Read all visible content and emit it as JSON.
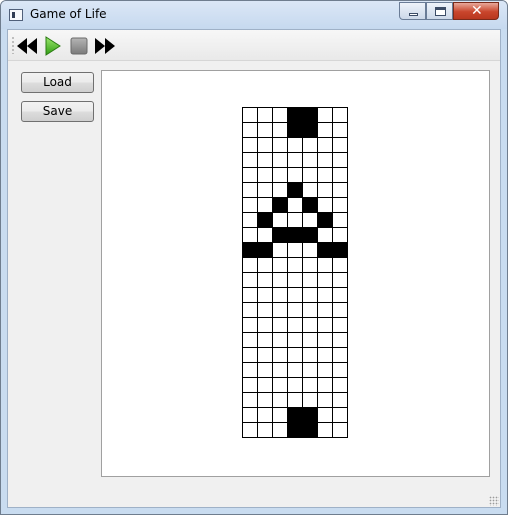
{
  "window": {
    "title": "Game of Life"
  },
  "toolbar": {
    "buttons": [
      {
        "icon": "rewind-icon",
        "color": "#000000"
      },
      {
        "icon": "play-icon",
        "color": "#3fbf1f"
      },
      {
        "icon": "stop-icon",
        "color": "#8c8c8c"
      },
      {
        "icon": "fast-forward-icon",
        "color": "#000000"
      }
    ]
  },
  "sidebar": {
    "load_label": "Load",
    "save_label": "Save"
  },
  "board": {
    "columns": 7,
    "rows": 22,
    "alive_color": "#000000",
    "dead_color": "#ffffff",
    "grid_color": "#000000",
    "live_cells": [
      [
        0,
        3
      ],
      [
        0,
        4
      ],
      [
        1,
        3
      ],
      [
        1,
        4
      ],
      [
        5,
        3
      ],
      [
        6,
        2
      ],
      [
        6,
        4
      ],
      [
        7,
        1
      ],
      [
        7,
        5
      ],
      [
        8,
        2
      ],
      [
        8,
        3
      ],
      [
        8,
        4
      ],
      [
        9,
        0
      ],
      [
        9,
        1
      ],
      [
        9,
        5
      ],
      [
        9,
        6
      ],
      [
        20,
        3
      ],
      [
        20,
        4
      ],
      [
        21,
        3
      ],
      [
        21,
        4
      ]
    ]
  }
}
